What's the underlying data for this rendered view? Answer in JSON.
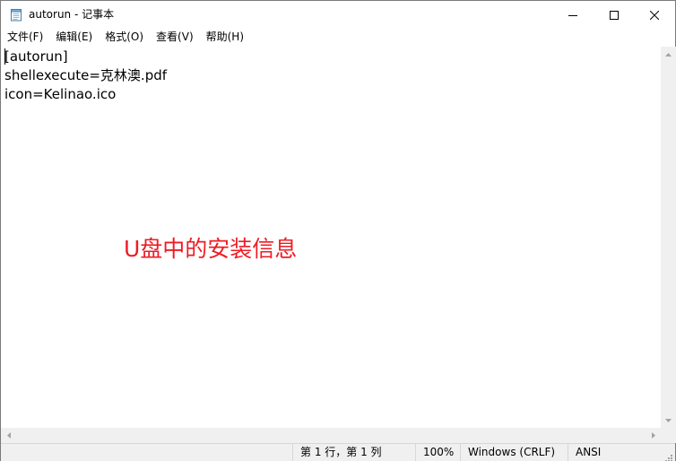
{
  "window": {
    "title": "autorun - 记事本",
    "icon": "notepad-icon",
    "buttons": {
      "minimize": "minimize-icon",
      "maximize": "maximize-icon",
      "close": "close-icon"
    }
  },
  "menu": {
    "items": [
      {
        "label": "文件(F)"
      },
      {
        "label": "编辑(E)"
      },
      {
        "label": "格式(O)"
      },
      {
        "label": "查看(V)"
      },
      {
        "label": "帮助(H)"
      }
    ]
  },
  "editor": {
    "lines": [
      "[autorun]",
      "shellexecute=克林澳.pdf",
      "icon=Kelinao.ico"
    ]
  },
  "annotation": {
    "text": "U盘中的安装信息",
    "color": "#ee1c25"
  },
  "statusbar": {
    "position": "第 1 行，第 1 列",
    "zoom": "100%",
    "line_ending": "Windows (CRLF)",
    "encoding": "ANSI"
  }
}
